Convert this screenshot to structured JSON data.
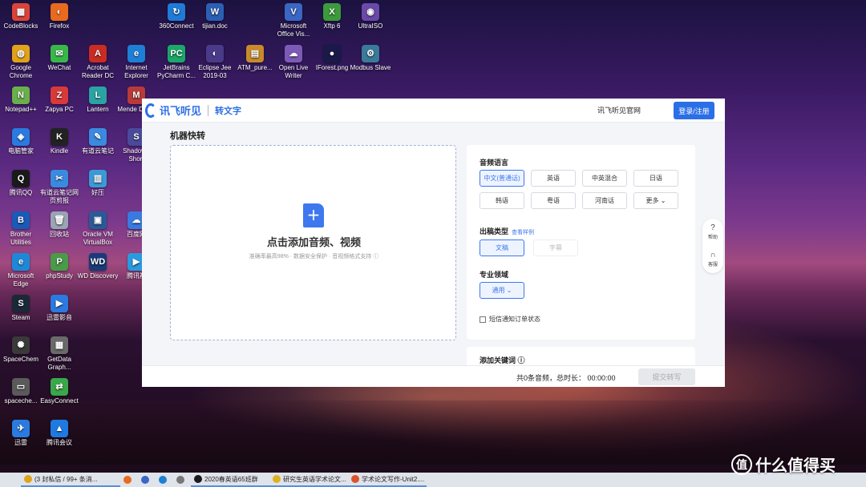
{
  "desktop": {
    "icons": [
      {
        "label": "CodeBlocks",
        "color": "#d9443a",
        "glyph": "▦"
      },
      {
        "label": "Firefox",
        "color": "#e86a1e",
        "glyph": "◐"
      },
      {
        "label": "360Connect",
        "color": "#1f7ad8",
        "glyph": "↻"
      },
      {
        "label": "tijian.doc",
        "color": "#2b5fb5",
        "glyph": "W"
      },
      {
        "label": "Microsoft Office Vis...",
        "color": "#3a66c4",
        "glyph": "V"
      },
      {
        "label": "Xftp 6",
        "color": "#3c9a3c",
        "glyph": "X"
      },
      {
        "label": "UltraISO",
        "color": "#6a4aa8",
        "glyph": "◉"
      },
      {
        "label": "Google Chrome",
        "color": "#e0a21b",
        "glyph": "◍"
      },
      {
        "label": "WeChat",
        "color": "#39b84a",
        "glyph": "✉"
      },
      {
        "label": "Acrobat Reader DC",
        "color": "#c92c22",
        "glyph": "A"
      },
      {
        "label": "Internet Explorer",
        "color": "#1e7fd6",
        "glyph": "e"
      },
      {
        "label": "JetBrains PyCharm C...",
        "color": "#1ba86a",
        "glyph": "PC"
      },
      {
        "label": "Eclipse Jee 2019-03",
        "color": "#4a3a8a",
        "glyph": "◐"
      },
      {
        "label": "ATM_pure...",
        "color": "#c88a2a",
        "glyph": "▤"
      },
      {
        "label": "Open Live Writer",
        "color": "#7d5ab8",
        "glyph": "☁"
      },
      {
        "label": "IForest.png",
        "color": "#1a1a4a",
        "glyph": "●"
      },
      {
        "label": "Modbus Slave",
        "color": "#3a7a9a",
        "glyph": "⚙"
      },
      {
        "label": "Notepad++",
        "color": "#6ab04a",
        "glyph": "N"
      },
      {
        "label": "Zapya PC",
        "color": "#d83a3a",
        "glyph": "Z"
      },
      {
        "label": "Lantern",
        "color": "#2ba3a3",
        "glyph": "L"
      },
      {
        "label": "Mende Deskt",
        "color": "#b83a3a",
        "glyph": "M"
      },
      {
        "label": "电脑管家",
        "color": "#2a7ae0",
        "glyph": "◈"
      },
      {
        "label": "Kindle",
        "color": "#222222",
        "glyph": "K"
      },
      {
        "label": "有道云笔记",
        "color": "#3a8ae0",
        "glyph": "✎"
      },
      {
        "label": "Shadow - Short",
        "color": "#4a4a9a",
        "glyph": "S"
      },
      {
        "label": "腾讯QQ",
        "color": "#1a1a1a",
        "glyph": "Q"
      },
      {
        "label": "有道云笔记网页剪报",
        "color": "#3a8ae0",
        "glyph": "✂"
      },
      {
        "label": "好压",
        "color": "#3a9ad8",
        "glyph": "▥"
      },
      {
        "label": "Brother Utilities",
        "color": "#1a5ab8",
        "glyph": "B"
      },
      {
        "label": "回收站",
        "color": "#9aa4b4",
        "glyph": "🗑"
      },
      {
        "label": "Oracle VM VirtualBox",
        "color": "#2a5a9a",
        "glyph": "▣"
      },
      {
        "label": "百度网",
        "color": "#3a7ae0",
        "glyph": "☁"
      },
      {
        "label": "Microsoft Edge",
        "color": "#1e88d8",
        "glyph": "e"
      },
      {
        "label": "phpStudy",
        "color": "#4a9a4a",
        "glyph": "P"
      },
      {
        "label": "WD Discovery",
        "color": "#1a3a7a",
        "glyph": "WD"
      },
      {
        "label": "腾讯视",
        "color": "#2a9ae0",
        "glyph": "▶"
      },
      {
        "label": "Steam",
        "color": "#1b2838",
        "glyph": "S"
      },
      {
        "label": "迅雷影音",
        "color": "#2a7ae0",
        "glyph": "▶"
      },
      {
        "label": "SpaceChem",
        "color": "#3a3a3a",
        "glyph": "✺"
      },
      {
        "label": "GetData Graph...",
        "color": "#6a6a6a",
        "glyph": "▦"
      },
      {
        "label": "spaceche...",
        "color": "#5a5a5a",
        "glyph": "▭"
      },
      {
        "label": "EasyConnect",
        "color": "#3aa84a",
        "glyph": "⇄"
      },
      {
        "label": "迅雷",
        "color": "#2a7ae0",
        "glyph": "✈"
      },
      {
        "label": "腾讯会议",
        "color": "#1e7ae0",
        "glyph": "▲"
      }
    ]
  },
  "app": {
    "logo_text": "讯飞听见",
    "logo_sub": "转文字",
    "site_link": "讯飞听见官网",
    "login_label": "登录/注册",
    "page_title": "机器快转",
    "upload": {
      "plus": "+",
      "title": "点击添加音频、视频",
      "subtitle": "准确率最高98% · 数据安全保护 · 音视频格式支持 ⓘ"
    },
    "settings": {
      "lang_label": "音频语言",
      "languages": [
        "中文(普通话)",
        "英语",
        "中英混合",
        "日语",
        "韩语",
        "粤语",
        "河南话",
        "更多 ⌄"
      ],
      "output_label": "出稿类型",
      "output_link": "查看样例",
      "output_options": [
        "文稿",
        "字幕"
      ],
      "domain_label": "专业领域",
      "domain_value": "通用 ⌄",
      "sms_label": "短信通知订单状态"
    },
    "keywords_label": "添加关键词 ⓘ",
    "side_tools": {
      "help": "帮助",
      "service": "客服"
    },
    "footer": {
      "summary": "共0条音频，总时长：  00:00:00",
      "submit_label": "提交转写"
    }
  },
  "taskbar": {
    "items": [
      {
        "label": "(3 封私信 / 99+ 条消...",
        "color": "#e0a21b"
      },
      {
        "label": "",
        "color": "#e86a1e"
      },
      {
        "label": "",
        "color": "#3a66c4"
      },
      {
        "label": "",
        "color": "#1e7fd6"
      },
      {
        "label": "",
        "color": "#777777"
      },
      {
        "label": "2020春英语65班群",
        "color": "#1a1a1a"
      },
      {
        "label": "研究生英语学术论文...",
        "color": "#e0b020"
      },
      {
        "label": "学术论文写作-Unit2....",
        "color": "#d8542a"
      }
    ]
  },
  "watermark": {
    "glyph": "值",
    "text": "什么值得买"
  }
}
